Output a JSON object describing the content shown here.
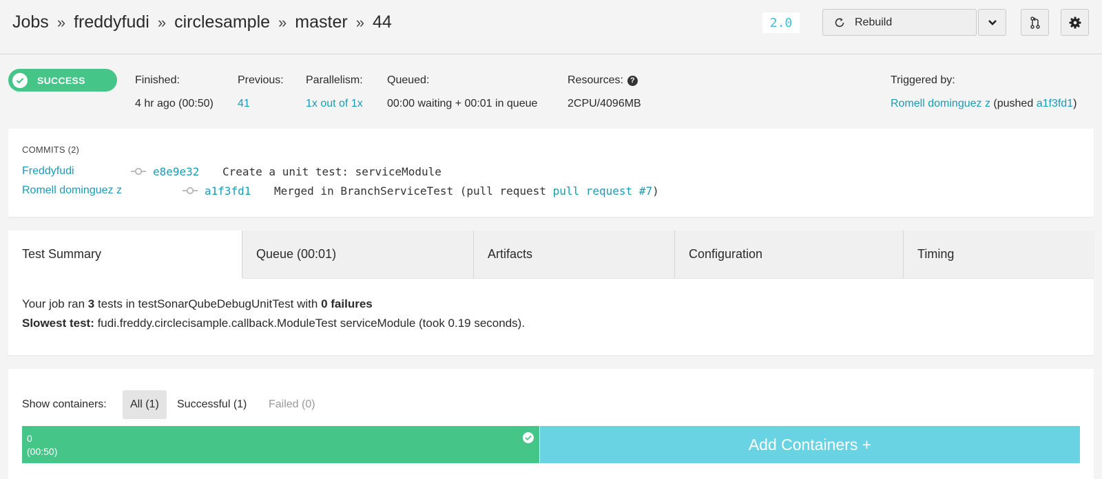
{
  "breadcrumb": {
    "items": [
      "Jobs",
      "freddyfudi",
      "circlesample",
      "master",
      "44"
    ],
    "separator": "»"
  },
  "header": {
    "version": "2.0",
    "rebuild_label": "Rebuild"
  },
  "status": {
    "badge": "SUCCESS",
    "finished_label": "Finished:",
    "finished_value": "4 hr ago (00:50)",
    "previous_label": "Previous:",
    "previous_value": "41",
    "parallelism_label": "Parallelism:",
    "parallelism_value": "1x out of 1x",
    "queued_label": "Queued:",
    "queued_value": "00:00 waiting + 00:01 in queue",
    "resources_label": "Resources:",
    "resources_value": "2CPU/4096MB",
    "triggered_label": "Triggered by:",
    "triggered_user": "Romell dominguez z",
    "triggered_pushed": "(pushed",
    "triggered_sha": "a1f3fd1",
    "triggered_close": ")"
  },
  "commits": {
    "title": "COMMITS (2)",
    "items": [
      {
        "author": "Freddyfudi",
        "sha": "e8e9e32",
        "message": "Create a unit test: serviceModule",
        "link": "",
        "suffix": ""
      },
      {
        "author": "Romell dominguez z",
        "sha": "a1f3fd1",
        "message": "Merged in BranchServiceTest (pull request ",
        "link": "pull request #7",
        "suffix": ")"
      }
    ]
  },
  "tabs": [
    {
      "label": "Test Summary",
      "active": true
    },
    {
      "label": "Queue (00:01)",
      "active": false
    },
    {
      "label": "Artifacts",
      "active": false
    },
    {
      "label": "Configuration",
      "active": false
    },
    {
      "label": "Timing",
      "active": false
    }
  ],
  "summary": {
    "line1_prefix": "Your job ran ",
    "line1_count": "3",
    "line1_mid": " tests in testSonarQubeDebugUnitTest with ",
    "line1_failures": "0 failures",
    "line2_label": "Slowest test:",
    "line2_value": " fudi.freddy.circlecisample.callback.ModuleTest serviceModule (took 0.19 seconds)."
  },
  "containers": {
    "show_label": "Show containers:",
    "filter_all": "All (1)",
    "filter_successful": "Successful (1)",
    "filter_failed": "Failed (0)",
    "container_index": "0",
    "container_time": "(00:50)",
    "add_label": "Add Containers +"
  },
  "colors": {
    "success": "#46c588",
    "link": "#1a9bb5",
    "add_containers": "#69d3e3"
  }
}
